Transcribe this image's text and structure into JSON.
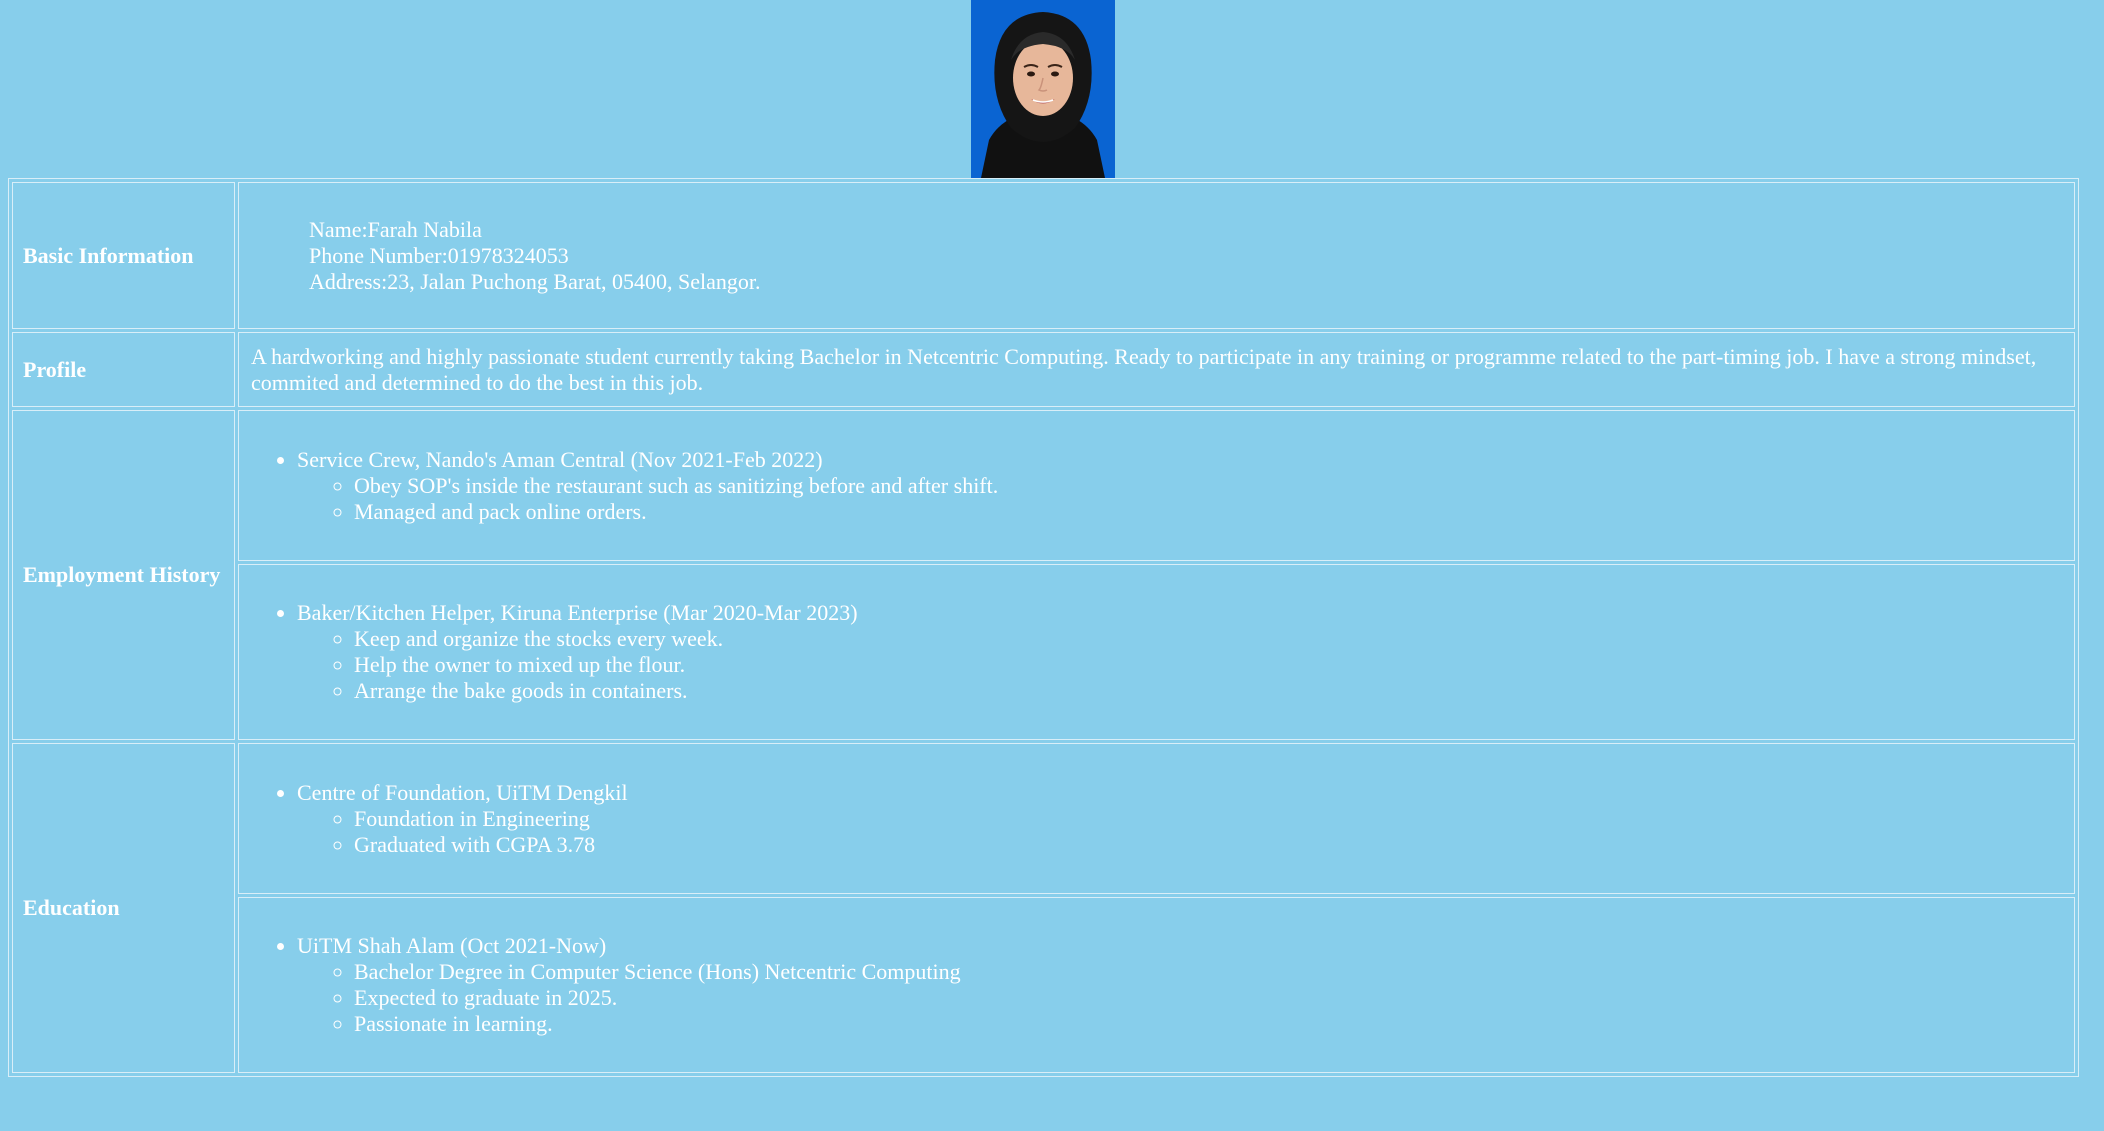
{
  "photo": {
    "alt": "profile photo",
    "background": "#0a64d2"
  },
  "sections": {
    "basic": {
      "label": "Basic Information",
      "name": "Name:Farah Nabila",
      "phone": "Phone Number:01978324053",
      "address": "Address:23, Jalan Puchong Barat, 05400, Selangor."
    },
    "profile": {
      "label": "Profile",
      "text": "A hardworking and highly passionate student currently taking Bachelor in Netcentric Computing. Ready to participate in any training or programme related to the part-timing job. I have a strong mindset, commited and determined to do the best in this job."
    },
    "employment": {
      "label": "Employment History",
      "jobs": [
        {
          "title": "Service Crew, Nando's Aman Central (Nov 2021-Feb 2022)",
          "points": [
            "Obey SOP's inside the restaurant such as sanitizing before and after shift.",
            "Managed and pack online orders."
          ]
        },
        {
          "title": "Baker/Kitchen Helper, Kiruna Enterprise (Mar 2020-Mar 2023)",
          "points": [
            "Keep and organize the stocks every week.",
            "Help the owner to mixed up the flour.",
            "Arrange the bake goods in containers."
          ]
        }
      ]
    },
    "education": {
      "label": "Education",
      "schools": [
        {
          "title": "Centre of Foundation, UiTM Dengkil",
          "points": [
            "Foundation in Engineering",
            "Graduated with CGPA 3.78"
          ]
        },
        {
          "title": "UiTM Shah Alam (Oct 2021-Now)",
          "points": [
            "Bachelor Degree in Computer Science (Hons) Netcentric Computing",
            "Expected to graduate in 2025.",
            "Passionate in learning."
          ]
        }
      ]
    }
  },
  "colors": {
    "page_background": "#87CEEB",
    "text": "#ffffff",
    "border": "#d8eef8"
  }
}
